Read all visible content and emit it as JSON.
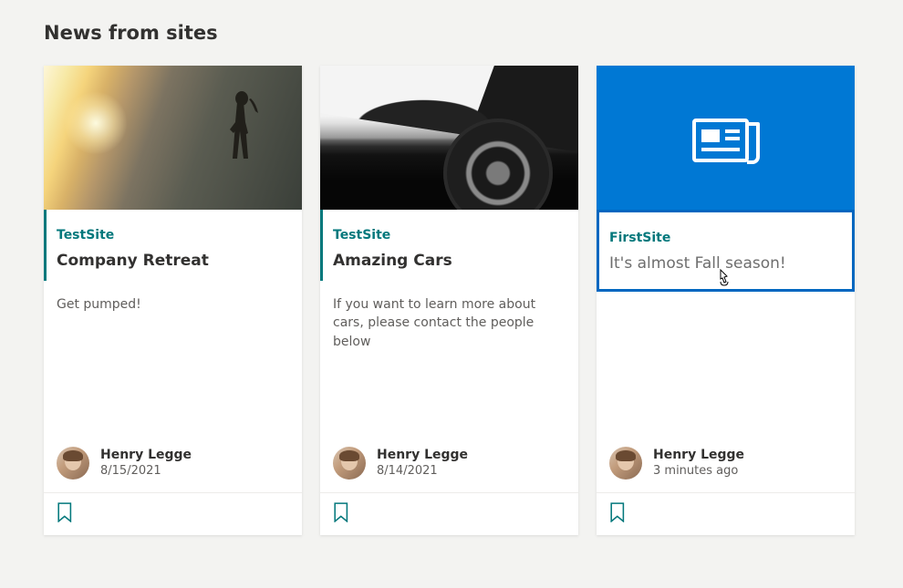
{
  "section_title": "News from sites",
  "cards": [
    {
      "site": "TestSite",
      "title": "Company Retreat",
      "desc": "Get pumped!",
      "author": "Henry Legge",
      "date": "8/15/2021",
      "thumb": "retreat"
    },
    {
      "site": "TestSite",
      "title": "Amazing Cars",
      "desc": "If you want to learn more about cars, please contact the people below",
      "author": "Henry Legge",
      "date": "8/14/2021",
      "thumb": "cars"
    },
    {
      "site": "FirstSite",
      "title": "It's almost Fall season!",
      "desc": "",
      "author": "Henry Legge",
      "date": "3 minutes ago",
      "thumb": "default",
      "highlighted": true
    }
  ],
  "icons": {
    "news": "news-icon",
    "bookmark": "bookmark-icon"
  }
}
